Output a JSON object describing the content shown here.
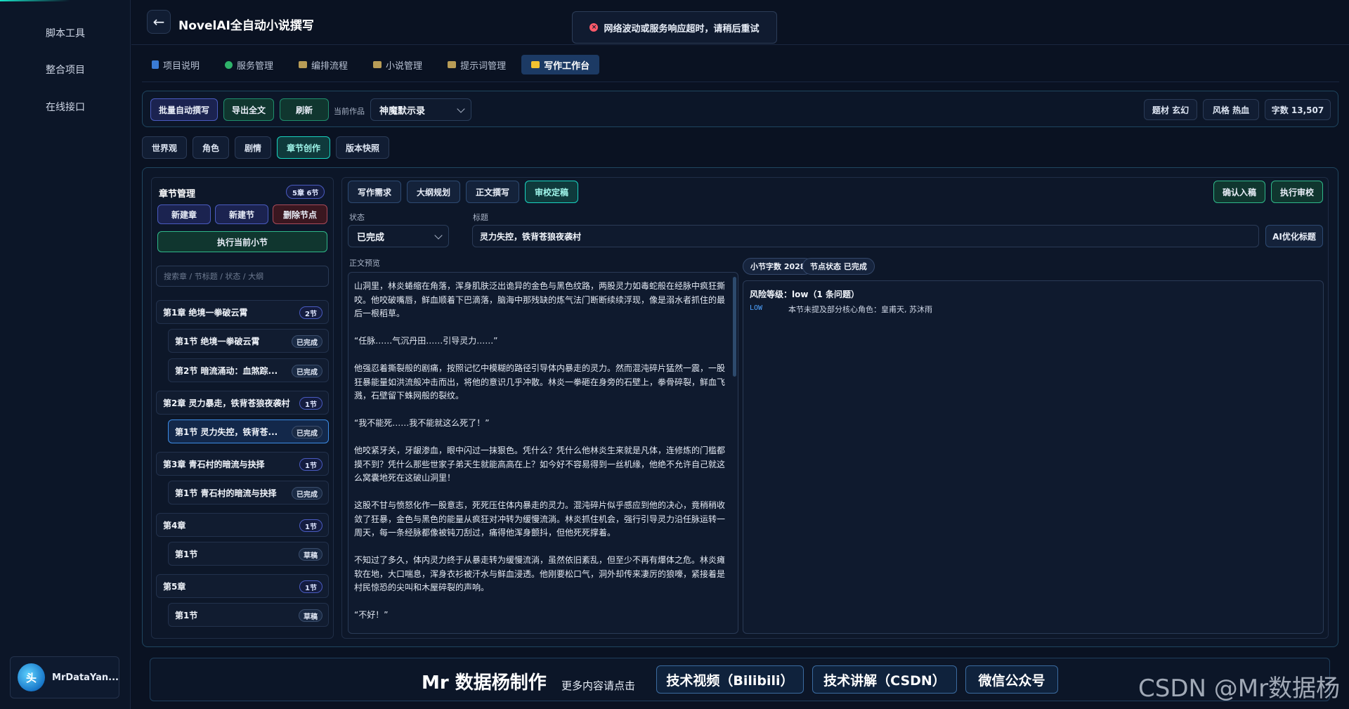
{
  "sidebar": {
    "items": [
      "脚本工具",
      "整合项目",
      "在线接口"
    ],
    "user": {
      "avatar_text": "头",
      "name": "MrDataYan..."
    }
  },
  "header": {
    "back_icon": "←",
    "title": "NovelAI全自动小说撰写"
  },
  "toast": {
    "icon": "×",
    "text": "网络波动或服务响应超时，请稍后重试",
    "color": "#ff5a6a"
  },
  "tabs": [
    {
      "label": "项目说明",
      "icon": "doc-icon"
    },
    {
      "label": "服务管理",
      "icon": "service-icon"
    },
    {
      "label": "编排流程",
      "icon": "folder-icon"
    },
    {
      "label": "小说管理",
      "icon": "folder-icon"
    },
    {
      "label": "提示词管理",
      "icon": "folder-icon"
    },
    {
      "label": "写作工作台",
      "icon": "folder-icon",
      "active": true
    }
  ],
  "toolbar": {
    "batch": "批量自动撰写",
    "export": "导出全文",
    "refresh": "刷新",
    "current_label": "当前作品",
    "current_work": "神魔默示录",
    "chips": [
      "题材 玄幻",
      "风格 热血",
      "字数 13,507"
    ]
  },
  "subtabs": [
    "世界观",
    "角色",
    "剧情",
    "章节创作",
    "版本快照"
  ],
  "chapters": {
    "title": "章节管理",
    "count": "5章 6节",
    "new_chapter": "新建章",
    "new_section": "新建节",
    "delete_node": "删除节点",
    "run_current": "执行当前小节",
    "search_placeholder": "搜索章 / 节标题 / 状态 / 大纲",
    "rows": [
      {
        "label": "第1章 绝境一拳破云霄",
        "badge": "2节",
        "kind": "chapter"
      },
      {
        "label": "第1节 绝境一拳破云霄",
        "badge": "已完成",
        "kind": "section"
      },
      {
        "label": "第2节 暗流涌动：血煞踪...",
        "badge": "已完成",
        "kind": "section"
      },
      {
        "label": "第2章 灵力暴走，铁背苍狼夜袭村",
        "badge": "1节",
        "kind": "chapter"
      },
      {
        "label": "第1节 灵力失控，铁背苍...",
        "badge": "已完成",
        "kind": "section",
        "selected": true
      },
      {
        "label": "第3章 青石村的暗流与抉择",
        "badge": "1节",
        "kind": "chapter"
      },
      {
        "label": "第1节 青石村的暗流与抉择",
        "badge": "已完成",
        "kind": "section"
      },
      {
        "label": "第4章",
        "badge": "1节",
        "kind": "chapter"
      },
      {
        "label": "第1节",
        "badge": "草稿",
        "kind": "section"
      },
      {
        "label": "第5章",
        "badge": "1节",
        "kind": "chapter"
      },
      {
        "label": "第1节",
        "badge": "草稿",
        "kind": "section"
      }
    ]
  },
  "editor": {
    "tabs": [
      "写作需求",
      "大纲规划",
      "正文撰写",
      "审校定稿"
    ],
    "confirm": "确认入稿",
    "run_review": "执行审校",
    "status_label": "状态",
    "status_value": "已完成",
    "title_label": "标题",
    "title_value": "灵力失控，铁背苍狼夜袭村",
    "ai_title": "AI优化标题",
    "preview_label": "正文预览",
    "word_count": "小节字数 2028",
    "node_status": "节点状态 已完成",
    "risk_title": "风险等级：low（1 条问题）",
    "risk_level": "LOW",
    "risk_text": "本节未提及部分核心角色：皇甫天, 苏沐雨",
    "paragraphs": [
      "山洞里，林炎蜷缩在角落，浑身肌肤泛出诡异的金色与黑色纹路，两股灵力如毒蛇般在经脉中疯狂撕咬。他咬破嘴唇，鲜血顺着下巴滴落，脑海中那残缺的炼气法门断断续续浮现，像是溺水者抓住的最后一根稻草。",
      "“任脉……气沉丹田……引导灵力……”",
      "他强忍着撕裂般的剧痛，按照记忆中模糊的路径引导体内暴走的灵力。然而混沌碎片猛然一震，一股狂暴能量如洪流般冲击而出，将他的意识几乎冲散。林炎一拳砸在身旁的石壁上，拳骨碎裂，鲜血飞溅，石壁留下蛛网般的裂纹。",
      "“我不能死……我不能就这么死了！”",
      "他咬紧牙关，牙龈渗血，眼中闪过一抹狠色。凭什么？凭什么他林炎生来就是凡体，连修炼的门槛都摸不到？凭什么那些世家子弟天生就能高高在上？如今好不容易得到一丝机缘，他绝不允许自己就这么窝囊地死在这破山洞里！",
      "这股不甘与愤怒化作一股意志，死死压住体内暴走的灵力。混沌碎片似乎感应到他的决心，竟稍稍收敛了狂暴，金色与黑色的能量从疯狂对冲转为缓慢流淌。林炎抓住机会，强行引导灵力沿任脉运转一周天，每一条经脉都像被钝刀刮过，痛得他浑身颤抖，但他死死撑着。",
      "不知过了多久，体内灵力终于从暴走转为缓慢流淌，虽然依旧紊乱，但至少不再有爆体之危。林炎瘫软在地，大口喘息，浑身衣衫被汗水与鲜血浸透。他刚要松口气，洞外却传来凄厉的狼嚎，紧接着是村民惊恐的尖叫和木屋碎裂的声响。",
      "“不好！”"
    ]
  },
  "footer": {
    "brand": "Mr 数据杨制作",
    "sub": "更多内容请点击",
    "links": [
      "技术视频（Bilibili）",
      "技术讲解（CSDN）",
      "微信公众号"
    ],
    "watermark": "CSDN @Mr数据杨"
  }
}
